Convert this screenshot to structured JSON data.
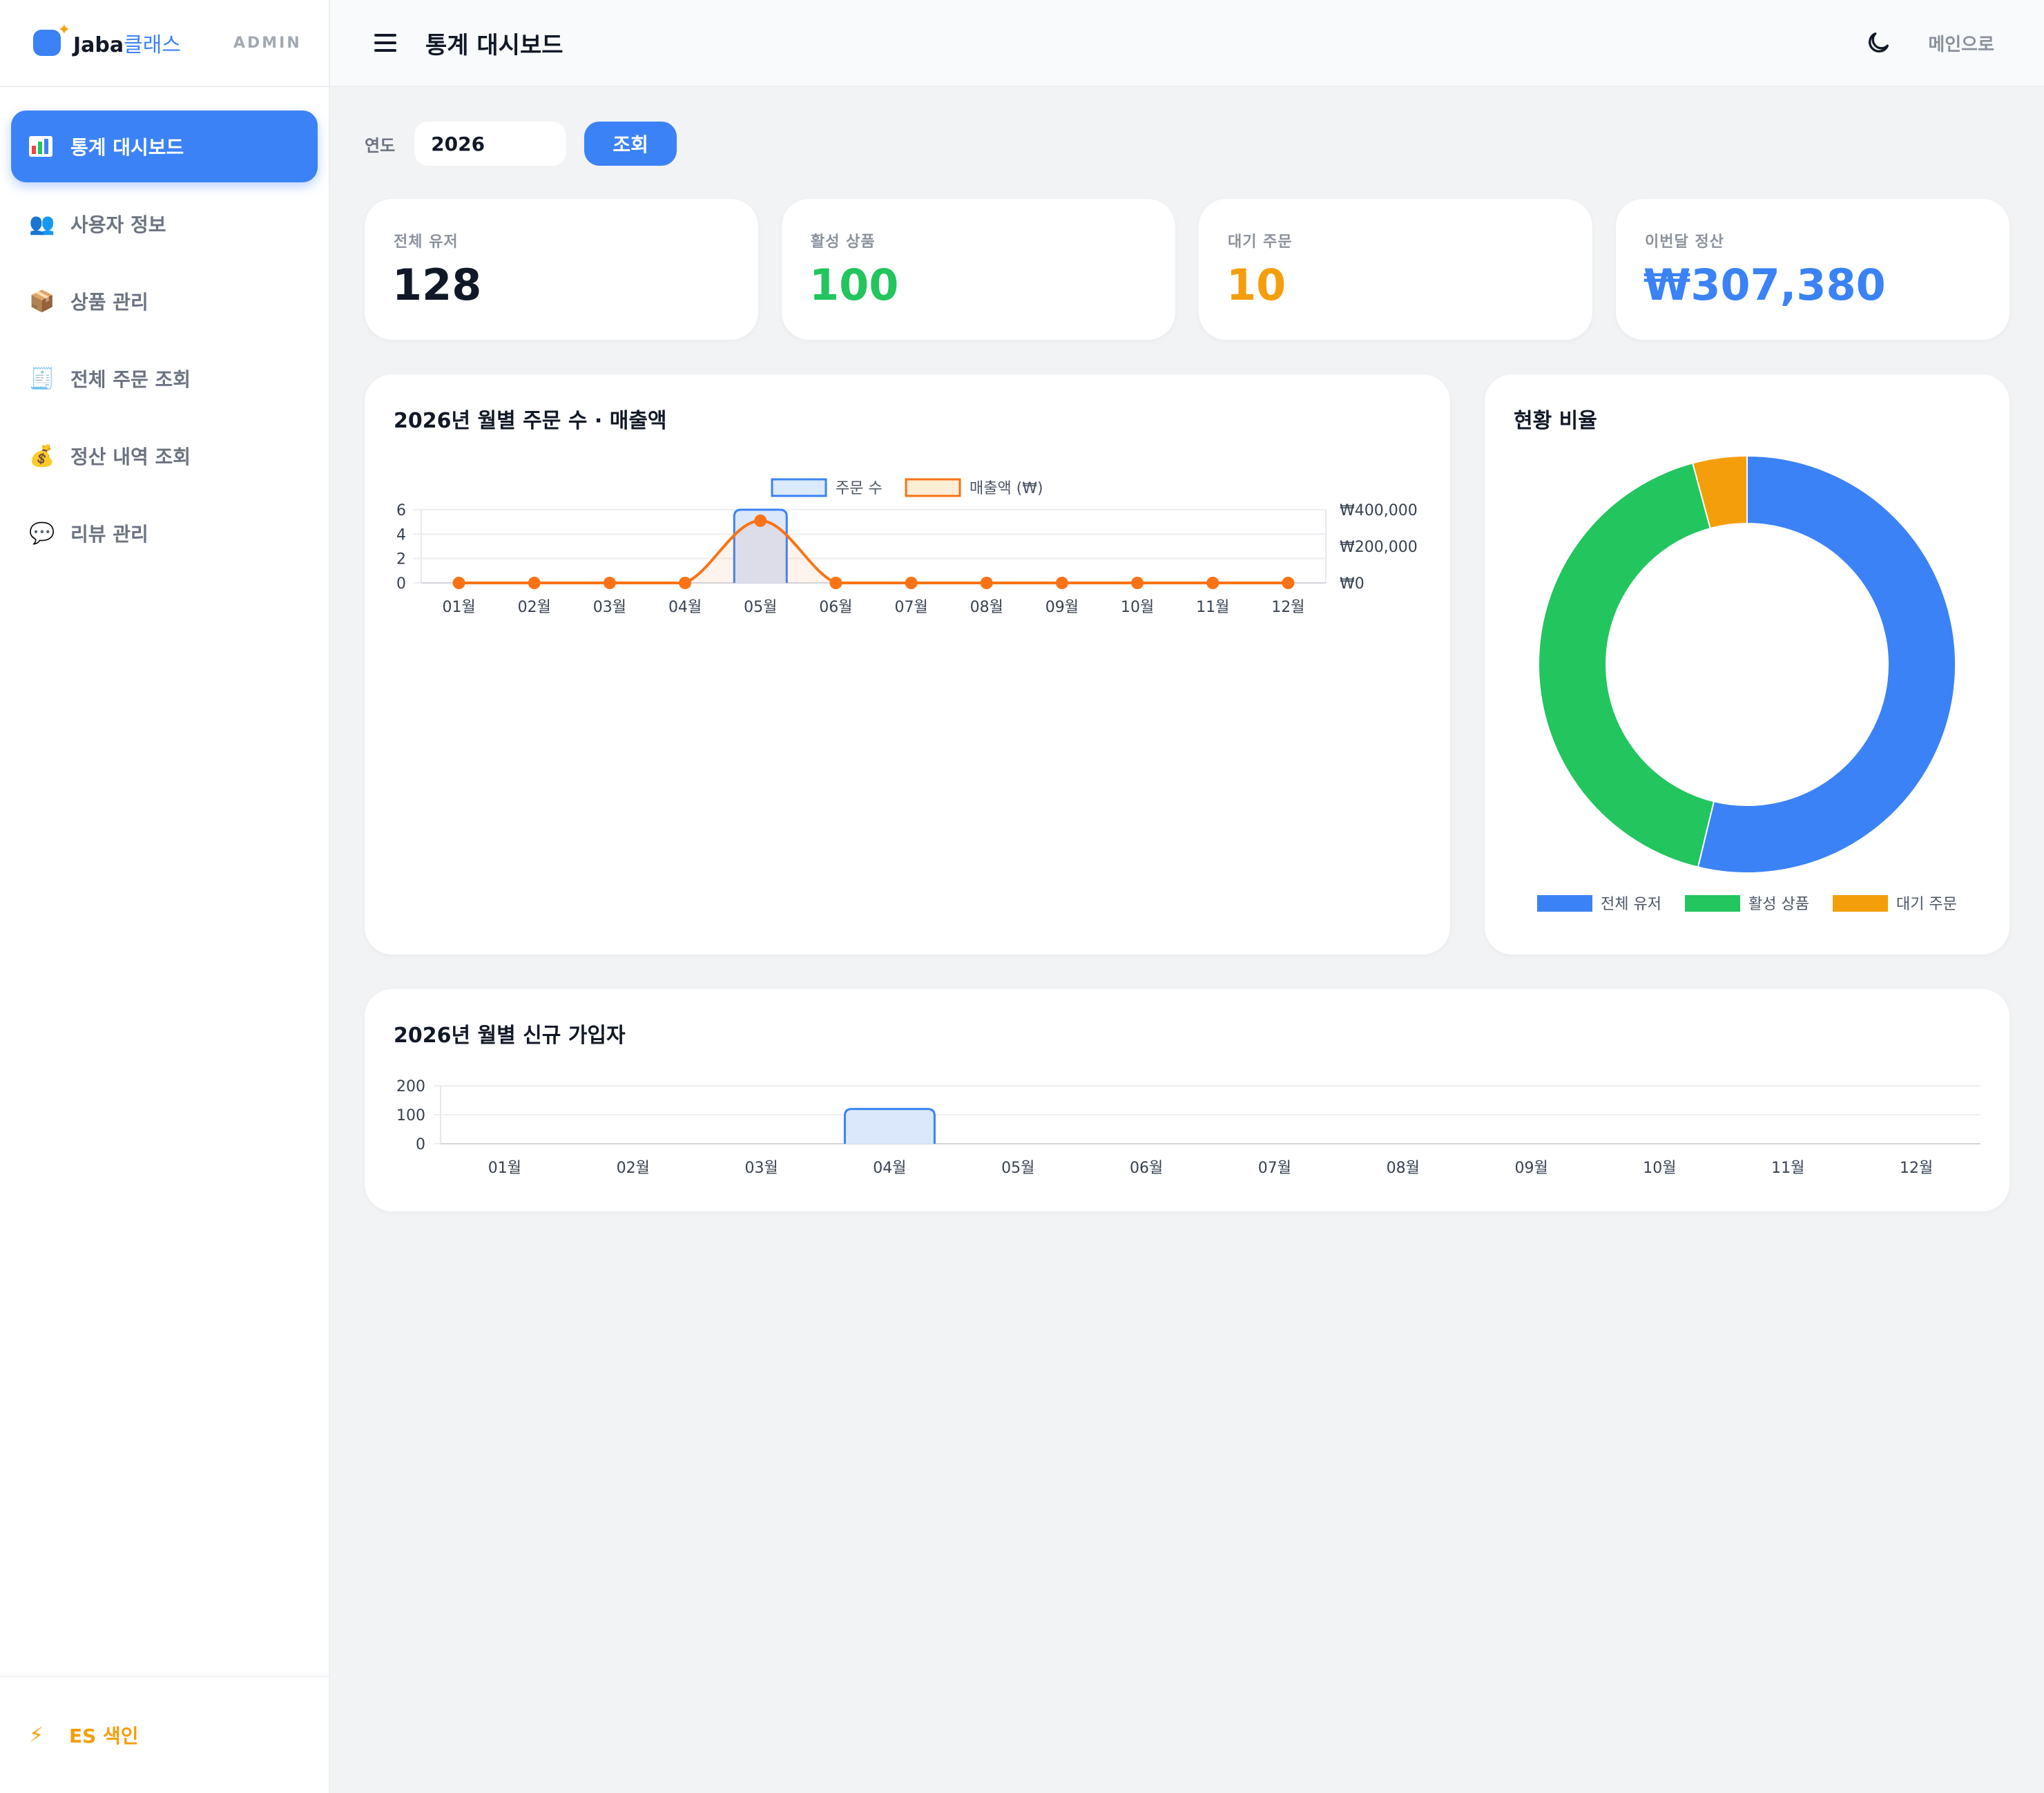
{
  "brand": {
    "name": "Jaba",
    "name_accent": "클래스",
    "admin_label": "ADMIN"
  },
  "sidebar": {
    "items": [
      {
        "label": "통계 대시보드",
        "icon": "bar-chart-icon",
        "active": true
      },
      {
        "label": "사용자 정보",
        "icon": "users-icon",
        "active": false
      },
      {
        "label": "상품 관리",
        "icon": "package-icon",
        "active": false
      },
      {
        "label": "전체 주문 조회",
        "icon": "receipt-icon",
        "active": false
      },
      {
        "label": "정산 내역 조회",
        "icon": "money-bag-icon",
        "active": false
      },
      {
        "label": "리뷰 관리",
        "icon": "speech-bubble-icon",
        "active": false
      }
    ],
    "footer": {
      "label": "ES 색인",
      "icon": "lightning-icon"
    }
  },
  "header": {
    "title": "통계 대시보드",
    "main_link": "메인으로",
    "theme_icon": "moon-icon",
    "menu_icon": "hamburger-icon"
  },
  "filter": {
    "label": "연도",
    "year": "2026",
    "button": "조회"
  },
  "stats": [
    {
      "label": "전체 유저",
      "value": "128",
      "color": "#111827"
    },
    {
      "label": "활성 상품",
      "value": "100",
      "color": "#22c55e"
    },
    {
      "label": "대기 주문",
      "value": "10",
      "color": "#f59e0b"
    },
    {
      "label": "이번달 정산",
      "value": "₩307,380",
      "color": "#3b82f6"
    }
  ],
  "colors": {
    "accent": "#3b82f6",
    "green": "#22c55e",
    "amber": "#f59e0b",
    "orange": "#f97316"
  },
  "chart_data": [
    {
      "type": "bar",
      "title": "2026년 월별 주문 수 · 매출액",
      "categories": [
        "01월",
        "02월",
        "03월",
        "04월",
        "05월",
        "06월",
        "07월",
        "08월",
        "09월",
        "10월",
        "11월",
        "12월"
      ],
      "series": [
        {
          "name": "주문 수",
          "type": "bar",
          "axis": "left",
          "values": [
            0,
            0,
            0,
            0,
            6,
            0,
            0,
            0,
            0,
            0,
            0,
            0
          ]
        },
        {
          "name": "매출액 (₩)",
          "type": "line",
          "axis": "right",
          "values": [
            0,
            0,
            0,
            0,
            340000,
            0,
            0,
            0,
            0,
            0,
            0,
            0
          ]
        }
      ],
      "y_left": {
        "ticks": [
          "0",
          "2",
          "4",
          "6"
        ],
        "ylim": [
          0,
          6
        ]
      },
      "y_right": {
        "ticks": [
          "₩0",
          "₩200,000",
          "₩400,000"
        ],
        "ylim": [
          0,
          400000
        ]
      },
      "legend": "top-center",
      "grid": true
    },
    {
      "type": "pie",
      "title": "현황 비율",
      "labels": [
        "전체 유저",
        "활성 상품",
        "대기 주문"
      ],
      "values": [
        128,
        100,
        10
      ],
      "colors": [
        "#3b82f6",
        "#22c55e",
        "#f59e0b"
      ],
      "legend": "bottom"
    },
    {
      "type": "bar",
      "title": "2026년 월별 신규 가입자",
      "categories": [
        "01월",
        "02월",
        "03월",
        "04월",
        "05월",
        "06월",
        "07월",
        "08월",
        "09월",
        "10월",
        "11월",
        "12월"
      ],
      "series": [
        {
          "name": "",
          "values": [
            0,
            0,
            0,
            120,
            0,
            0,
            0,
            0,
            0,
            0,
            0,
            0
          ]
        }
      ],
      "y_ticks": [
        "0",
        "100",
        "200"
      ],
      "ylim": [
        0,
        200
      ],
      "grid": true
    }
  ]
}
